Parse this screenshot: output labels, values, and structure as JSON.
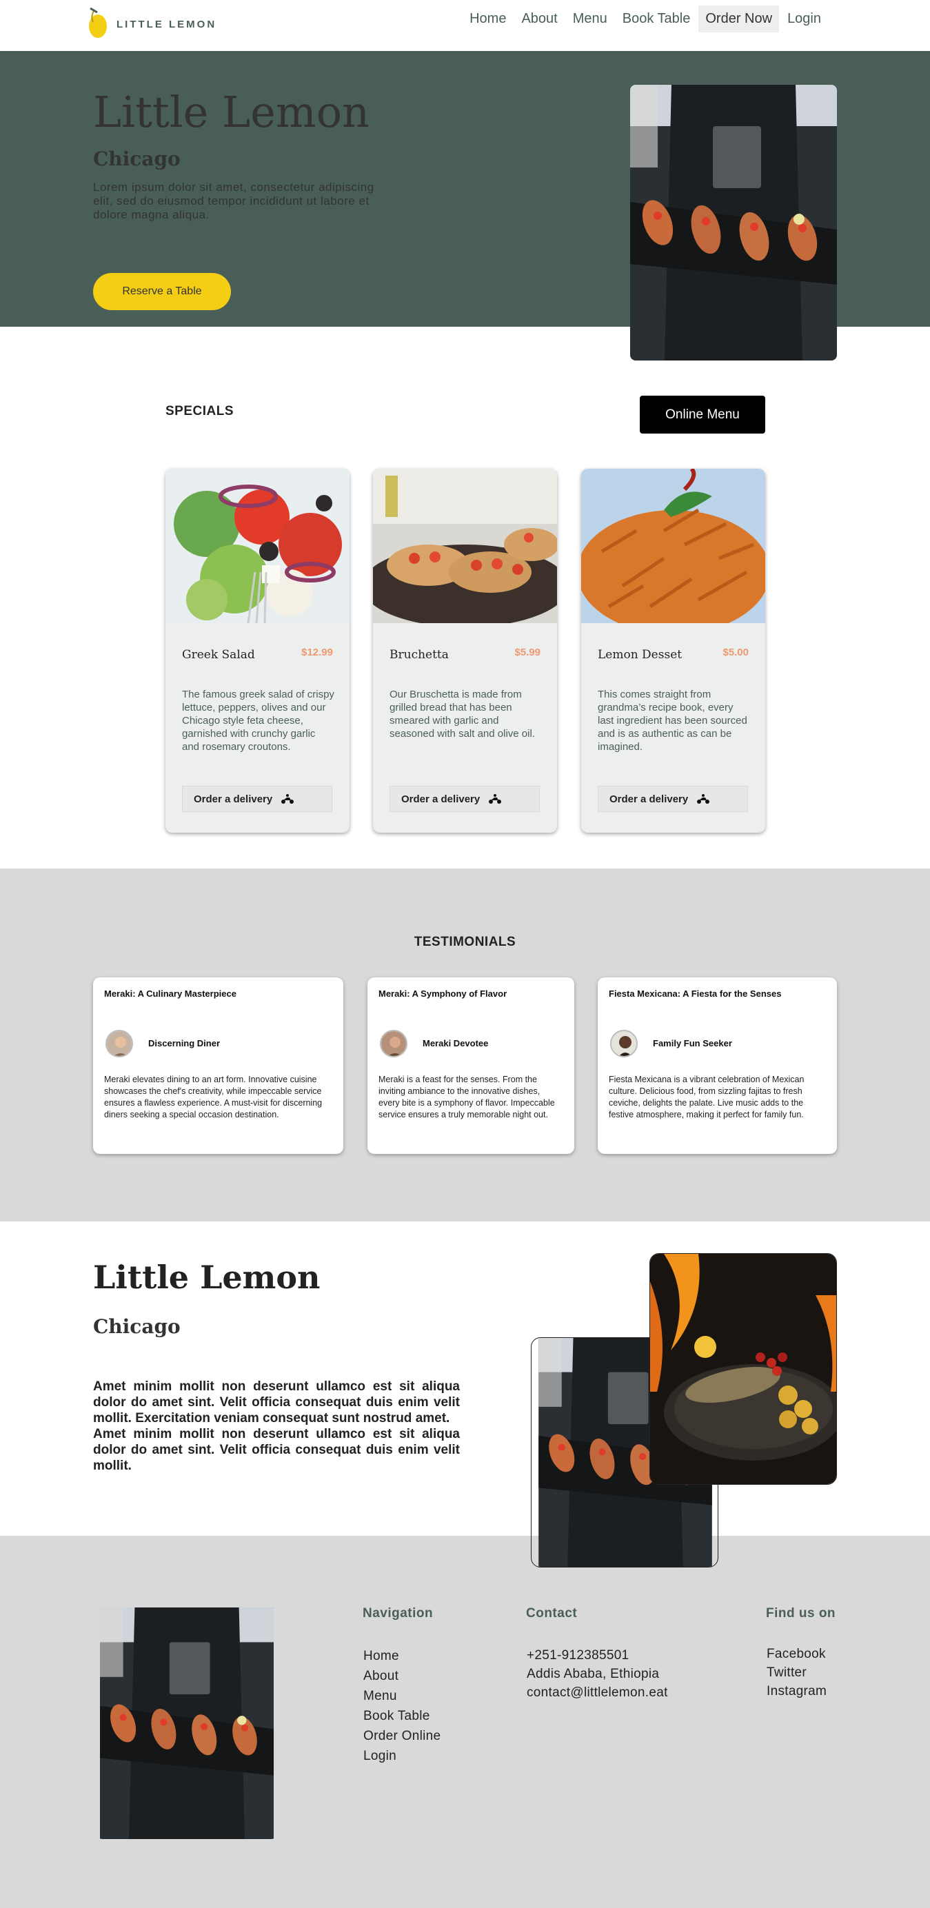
{
  "brand": {
    "name": "LITTLE LEMON",
    "accent": "#f4ce14",
    "primary": "#495e57",
    "highlight": "#ee9972"
  },
  "nav": {
    "items": [
      "Home",
      "About",
      "Menu",
      "Book Table",
      "Order Now",
      "Login"
    ],
    "active": "Order Now"
  },
  "hero": {
    "title": "Little Lemon",
    "subtitle": "Chicago",
    "description": "Lorem ipsum dolor sit amet, consectetur adipiscing elit, sed do eiusmod tempor incididunt ut labore et dolore magna aliqua.",
    "cta": "Reserve a Table"
  },
  "specials": {
    "title": "SPECIALS",
    "menu_button": "Online Menu",
    "items": [
      {
        "name": "Greek Salad",
        "price": "$12.99",
        "description": "The famous greek salad of crispy lettuce, peppers, olives and our Chicago style feta cheese, garnished with crunchy garlic and rosemary croutons.",
        "order": "Order a delivery"
      },
      {
        "name": "Bruchetta",
        "price": "$5.99",
        "description": "Our Bruschetta is made from grilled bread that has been smeared with garlic and seasoned with salt and olive oil.",
        "order": "Order a delivery"
      },
      {
        "name": "Lemon Desset",
        "price": "$5.00",
        "description": "This comes straight from grandma’s recipe book, every last ingredient has been sourced and is as authentic as can be imagined.",
        "order": "Order a delivery"
      }
    ]
  },
  "testimonials": {
    "title": "TESTIMONIALS",
    "items": [
      {
        "title": "Meraki: A Culinary Masterpiece",
        "reviewer": "Discerning Diner",
        "review": "Meraki elevates dining to an art form. Innovative cuisine showcases the chef's creativity, while impeccable service ensures a flawless experience. A must-visit for discerning diners seeking a special occasion destination."
      },
      {
        "title": "Meraki: A Symphony of Flavor",
        "reviewer": "Meraki Devotee",
        "review": "Meraki is a feast for the senses. From the inviting ambiance to the innovative dishes, every bite is a symphony of flavor. Impeccable service ensures a truly memorable night out."
      },
      {
        "title": "Fiesta Mexicana: A Fiesta for the Senses",
        "reviewer": "Family Fun Seeker",
        "review": "Fiesta Mexicana is a vibrant celebration of Mexican culture. Delicious food, from sizzling fajitas to fresh ceviche, delights the palate. Live music adds to the festive atmosphere, making it perfect for family fun."
      }
    ]
  },
  "about": {
    "title": "Little Lemon",
    "subtitle": "Chicago",
    "paragraph1": "Amet minim mollit non deserunt ullamco est sit aliqua dolor do amet sint. Velit officia consequat duis enim velit mollit. Exercitation veniam consequat sunt nostrud amet.",
    "paragraph2": "Amet minim mollit non deserunt ullamco est sit aliqua dolor do amet sint. Velit officia consequat duis enim velit mollit."
  },
  "footer": {
    "navigation": {
      "title": "Navigation",
      "items": [
        "Home",
        "About",
        "Menu",
        "Book Table",
        "Order Online",
        "Login"
      ]
    },
    "contact": {
      "title": "Contact",
      "items": [
        "+251-912385501",
        "Addis Ababa, Ethiopia",
        "contact@littlelemon.eat"
      ]
    },
    "social": {
      "title": "Find us on",
      "items": [
        "Facebook",
        "Twitter",
        "Instagram"
      ]
    }
  }
}
